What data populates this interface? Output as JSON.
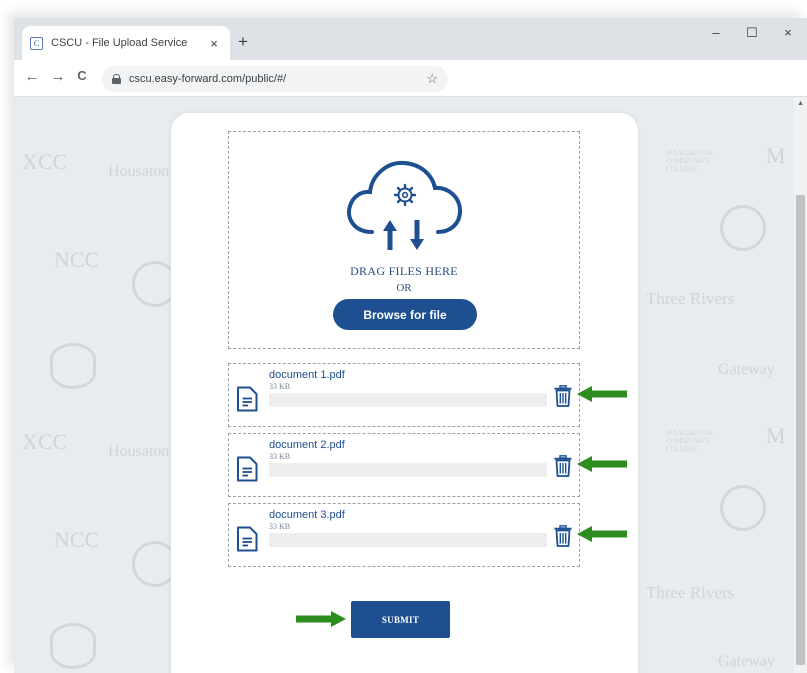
{
  "browser": {
    "tab_title": "CSCU - File Upload Service",
    "tab_favicon_letter": "C",
    "tab_close_glyph": "×",
    "new_tab_glyph": "+",
    "url": "cscu.easy-forward.com/public/#/",
    "controls": {
      "minimize": "–",
      "maximize": "☐",
      "close": "×"
    },
    "nav": {
      "back": "←",
      "forward": "→",
      "reload": "C"
    },
    "star_glyph": "☆"
  },
  "upload": {
    "drag_text": "DRAG FILES HERE",
    "or_text": "OR",
    "browse_label": "Browse for file",
    "submit_label": "SUBMIT"
  },
  "files": [
    {
      "name": "document 1.pdf",
      "size": "33 KB",
      "progress": 0
    },
    {
      "name": "document 2.pdf",
      "size": "33 KB",
      "progress": 0
    },
    {
      "name": "document 3.pdf",
      "size": "33 KB",
      "progress": 0
    }
  ],
  "background_logos": {
    "three_rivers": "Three Rivers",
    "gateway": "Gateway",
    "ncc": "NCC",
    "housatonic": "Housatonic",
    "manchester": "MANCHESTER COMMUNITY COLLEGE"
  },
  "colors": {
    "brand_blue": "#1d4f91",
    "annotation_green": "#2e8b1f"
  },
  "icons": {
    "cloud": "cloud-upload-gear-icon",
    "file": "document-icon",
    "trash": "trash-icon",
    "arrow": "green-arrow-icon"
  }
}
